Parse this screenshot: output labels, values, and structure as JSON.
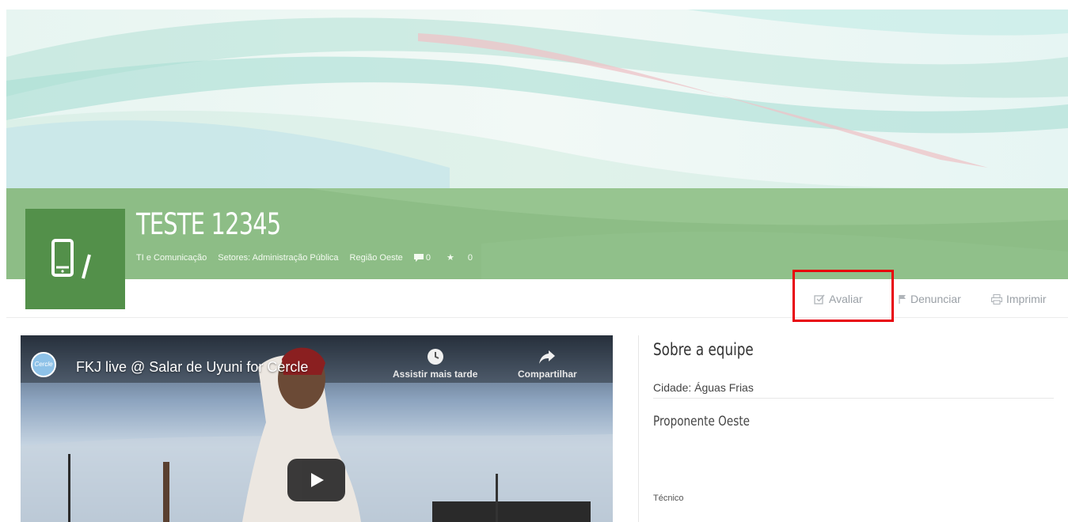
{
  "project": {
    "title": "TESTE 12345",
    "category": "TI e Comunicação",
    "sectors": "Setores: Administração Pública",
    "region": "Região Oeste",
    "comments_count": "0",
    "stars_count": "0"
  },
  "actions": {
    "evaluate": "Avaliar",
    "report": "Denunciar",
    "print": "Imprimir"
  },
  "video": {
    "title": "FKJ live @ Salar de Uyuni for Cercle",
    "channel": "Cercle",
    "watch_later": "Assistir mais tarde",
    "share": "Compartilhar"
  },
  "team": {
    "heading": "Sobre a equipe",
    "city": "Cidade: Águas Frias",
    "proponent": "Proponente Oeste",
    "role": "Técnico"
  },
  "colors": {
    "header_green": "#8dbd86",
    "logo_green": "#53904a",
    "highlight_red": "#e8000b"
  }
}
